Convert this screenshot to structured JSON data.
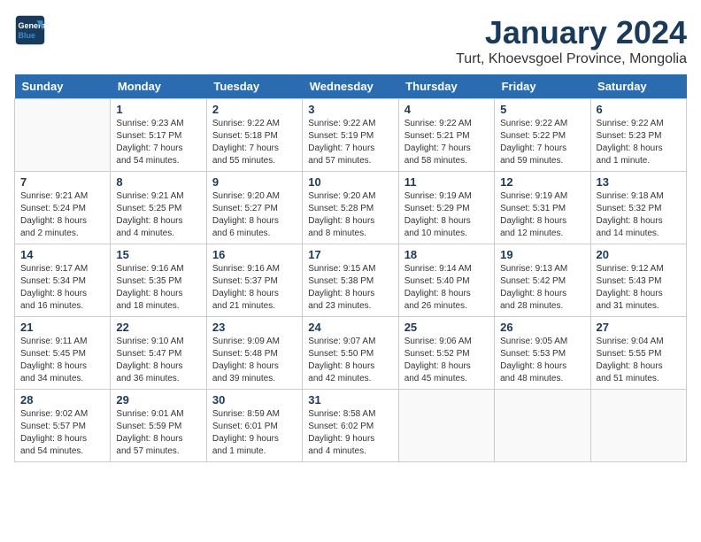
{
  "logo": {
    "line1": "General",
    "line2": "Blue"
  },
  "title": "January 2024",
  "subtitle": "Turt, Khoevsgoel Province, Mongolia",
  "days_of_week": [
    "Sunday",
    "Monday",
    "Tuesday",
    "Wednesday",
    "Thursday",
    "Friday",
    "Saturday"
  ],
  "weeks": [
    [
      {
        "day": "",
        "info": ""
      },
      {
        "day": "1",
        "info": "Sunrise: 9:23 AM\nSunset: 5:17 PM\nDaylight: 7 hours\nand 54 minutes."
      },
      {
        "day": "2",
        "info": "Sunrise: 9:22 AM\nSunset: 5:18 PM\nDaylight: 7 hours\nand 55 minutes."
      },
      {
        "day": "3",
        "info": "Sunrise: 9:22 AM\nSunset: 5:19 PM\nDaylight: 7 hours\nand 57 minutes."
      },
      {
        "day": "4",
        "info": "Sunrise: 9:22 AM\nSunset: 5:21 PM\nDaylight: 7 hours\nand 58 minutes."
      },
      {
        "day": "5",
        "info": "Sunrise: 9:22 AM\nSunset: 5:22 PM\nDaylight: 7 hours\nand 59 minutes."
      },
      {
        "day": "6",
        "info": "Sunrise: 9:22 AM\nSunset: 5:23 PM\nDaylight: 8 hours\nand 1 minute."
      }
    ],
    [
      {
        "day": "7",
        "info": "Sunrise: 9:21 AM\nSunset: 5:24 PM\nDaylight: 8 hours\nand 2 minutes."
      },
      {
        "day": "8",
        "info": "Sunrise: 9:21 AM\nSunset: 5:25 PM\nDaylight: 8 hours\nand 4 minutes."
      },
      {
        "day": "9",
        "info": "Sunrise: 9:20 AM\nSunset: 5:27 PM\nDaylight: 8 hours\nand 6 minutes."
      },
      {
        "day": "10",
        "info": "Sunrise: 9:20 AM\nSunset: 5:28 PM\nDaylight: 8 hours\nand 8 minutes."
      },
      {
        "day": "11",
        "info": "Sunrise: 9:19 AM\nSunset: 5:29 PM\nDaylight: 8 hours\nand 10 minutes."
      },
      {
        "day": "12",
        "info": "Sunrise: 9:19 AM\nSunset: 5:31 PM\nDaylight: 8 hours\nand 12 minutes."
      },
      {
        "day": "13",
        "info": "Sunrise: 9:18 AM\nSunset: 5:32 PM\nDaylight: 8 hours\nand 14 minutes."
      }
    ],
    [
      {
        "day": "14",
        "info": "Sunrise: 9:17 AM\nSunset: 5:34 PM\nDaylight: 8 hours\nand 16 minutes."
      },
      {
        "day": "15",
        "info": "Sunrise: 9:16 AM\nSunset: 5:35 PM\nDaylight: 8 hours\nand 18 minutes."
      },
      {
        "day": "16",
        "info": "Sunrise: 9:16 AM\nSunset: 5:37 PM\nDaylight: 8 hours\nand 21 minutes."
      },
      {
        "day": "17",
        "info": "Sunrise: 9:15 AM\nSunset: 5:38 PM\nDaylight: 8 hours\nand 23 minutes."
      },
      {
        "day": "18",
        "info": "Sunrise: 9:14 AM\nSunset: 5:40 PM\nDaylight: 8 hours\nand 26 minutes."
      },
      {
        "day": "19",
        "info": "Sunrise: 9:13 AM\nSunset: 5:42 PM\nDaylight: 8 hours\nand 28 minutes."
      },
      {
        "day": "20",
        "info": "Sunrise: 9:12 AM\nSunset: 5:43 PM\nDaylight: 8 hours\nand 31 minutes."
      }
    ],
    [
      {
        "day": "21",
        "info": "Sunrise: 9:11 AM\nSunset: 5:45 PM\nDaylight: 8 hours\nand 34 minutes."
      },
      {
        "day": "22",
        "info": "Sunrise: 9:10 AM\nSunset: 5:47 PM\nDaylight: 8 hours\nand 36 minutes."
      },
      {
        "day": "23",
        "info": "Sunrise: 9:09 AM\nSunset: 5:48 PM\nDaylight: 8 hours\nand 39 minutes."
      },
      {
        "day": "24",
        "info": "Sunrise: 9:07 AM\nSunset: 5:50 PM\nDaylight: 8 hours\nand 42 minutes."
      },
      {
        "day": "25",
        "info": "Sunrise: 9:06 AM\nSunset: 5:52 PM\nDaylight: 8 hours\nand 45 minutes."
      },
      {
        "day": "26",
        "info": "Sunrise: 9:05 AM\nSunset: 5:53 PM\nDaylight: 8 hours\nand 48 minutes."
      },
      {
        "day": "27",
        "info": "Sunrise: 9:04 AM\nSunset: 5:55 PM\nDaylight: 8 hours\nand 51 minutes."
      }
    ],
    [
      {
        "day": "28",
        "info": "Sunrise: 9:02 AM\nSunset: 5:57 PM\nDaylight: 8 hours\nand 54 minutes."
      },
      {
        "day": "29",
        "info": "Sunrise: 9:01 AM\nSunset: 5:59 PM\nDaylight: 8 hours\nand 57 minutes."
      },
      {
        "day": "30",
        "info": "Sunrise: 8:59 AM\nSunset: 6:01 PM\nDaylight: 9 hours\nand 1 minute."
      },
      {
        "day": "31",
        "info": "Sunrise: 8:58 AM\nSunset: 6:02 PM\nDaylight: 9 hours\nand 4 minutes."
      },
      {
        "day": "",
        "info": ""
      },
      {
        "day": "",
        "info": ""
      },
      {
        "day": "",
        "info": ""
      }
    ]
  ]
}
